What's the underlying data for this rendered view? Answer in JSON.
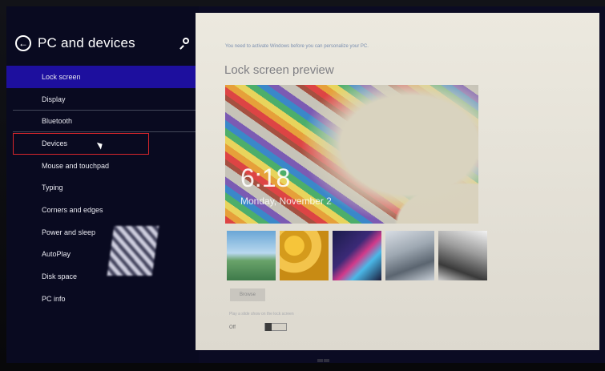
{
  "header": {
    "title": "PC and devices"
  },
  "sidebar": {
    "items": [
      {
        "label": "Lock screen"
      },
      {
        "label": "Display"
      },
      {
        "label": "Bluetooth"
      },
      {
        "label": "Devices"
      },
      {
        "label": "Mouse and touchpad"
      },
      {
        "label": "Typing"
      },
      {
        "label": "Corners and edges"
      },
      {
        "label": "Power and sleep"
      },
      {
        "label": "AutoPlay"
      },
      {
        "label": "Disk space"
      },
      {
        "label": "PC info"
      }
    ],
    "selected": "Lock screen",
    "highlighted": "Devices"
  },
  "content": {
    "notice": "You need to activate Windows before you can personalize your PC.",
    "preview_title": "Lock screen preview",
    "lock_time": "6:18",
    "lock_date": "Monday, November 2",
    "browse_label": "Browse",
    "slideshow_label": "Play a slide show on the lock screen",
    "slideshow_state": "Off"
  },
  "colors": {
    "sidebar_background": "#090a20",
    "selected_item": "#1d0f9e",
    "highlight_box": "#d8262b",
    "content_background": "#ece9df"
  },
  "icons": {
    "back": "back-arrow-icon",
    "search": "search-icon",
    "cursor": "mouse-cursor-icon"
  }
}
